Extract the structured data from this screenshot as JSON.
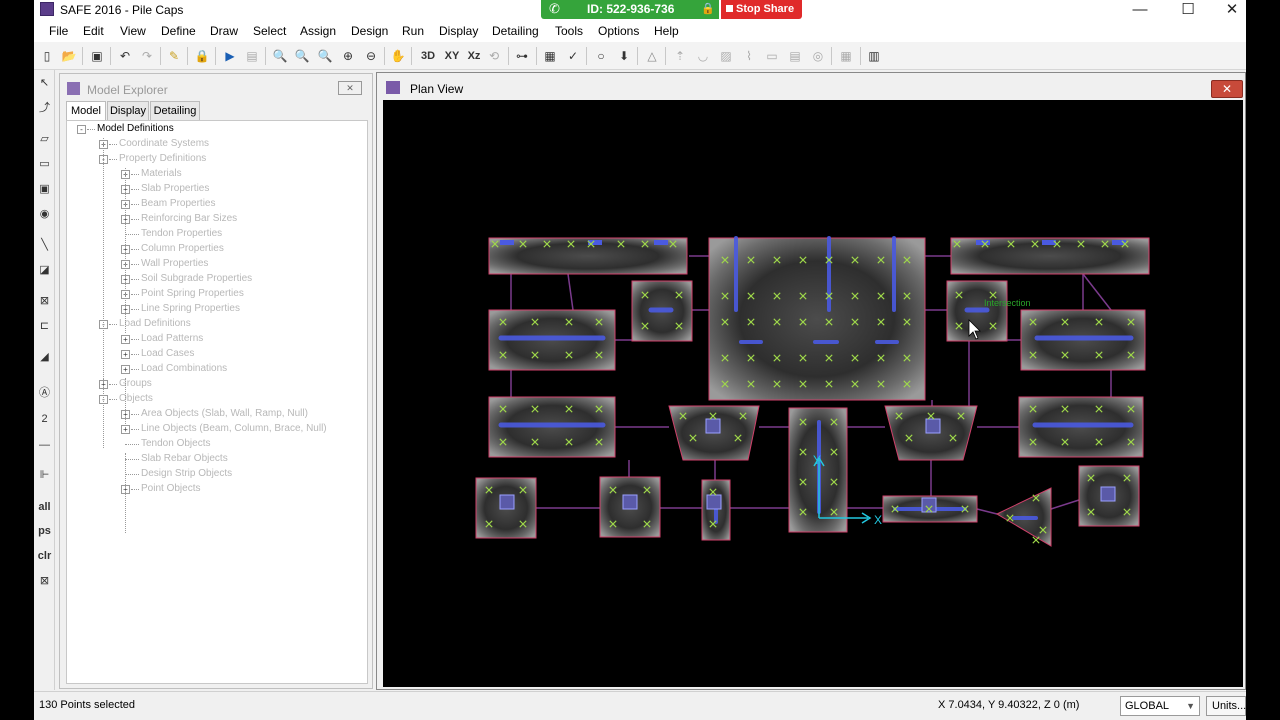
{
  "app": {
    "title": "SAFE 2016 - Pile Caps"
  },
  "window_controls": {
    "minimize": "—",
    "maximize": "☐",
    "close": "✕"
  },
  "share": {
    "id_label": "ID: 522-936-736",
    "stop_label": "Stop Share"
  },
  "menu": [
    "File",
    "Edit",
    "View",
    "Define",
    "Draw",
    "Select",
    "Assign",
    "Design",
    "Run",
    "Display",
    "Detailing",
    "Tools",
    "Options",
    "Help"
  ],
  "toolbar": {
    "btn_3d": "3D",
    "btn_xy": "XY",
    "btn_xz": "Xz"
  },
  "left_tools": {
    "all": "all",
    "ps": "ps",
    "clr": "clr",
    "two": "2"
  },
  "explorer": {
    "title": "Model Explorer",
    "tabs": [
      "Model",
      "Display",
      "Detailing"
    ],
    "tree": [
      "Model Definitions",
      "Coordinate Systems",
      "Property Definitions",
      "Materials",
      "Slab Properties",
      "Beam Properties",
      "Reinforcing Bar Sizes",
      "Tendon Properties",
      "Column Properties",
      "Wall Properties",
      "Soil Subgrade Properties",
      "Point Spring Properties",
      "Line Spring Properties",
      "Load Definitions",
      "Load Patterns",
      "Load Cases",
      "Load Combinations",
      "Groups",
      "Objects",
      "Area Objects (Slab, Wall, Ramp, Null)",
      "Line Objects (Beam, Column, Brace, Null)",
      "Tendon Objects",
      "Slab Rebar Objects",
      "Design Strip Objects",
      "Point Objects"
    ]
  },
  "plan": {
    "title": "Plan View",
    "axis_x": "X",
    "axis_y": "Y",
    "tooltip": "Intersection"
  },
  "status": {
    "left": "130 Points selected",
    "coords": "X 7.0434,  Y 9.40322,  Z 0   (m)",
    "coord_system": "GLOBAL",
    "units_button": "Units..."
  },
  "colors": {
    "canvas_bg": "#000000",
    "pile_cross": "#9fd84a",
    "outline": "#d0406a",
    "beam": "#4a5ae0",
    "share_green": "#35a43b",
    "share_red": "#e02a2a"
  }
}
